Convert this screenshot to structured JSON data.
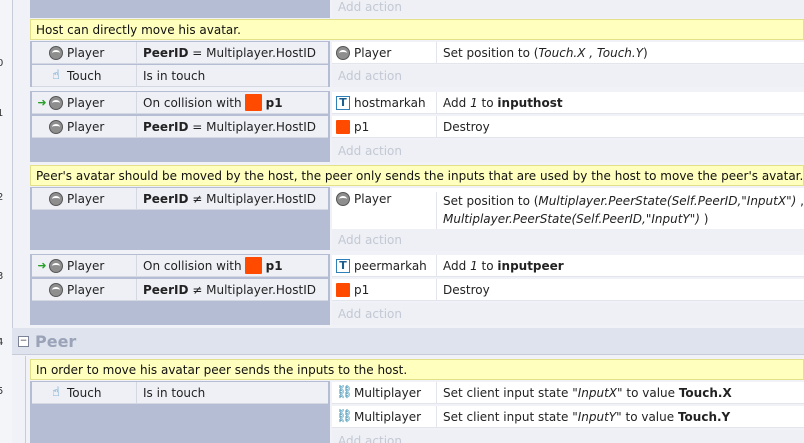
{
  "top_add_action": "Add action",
  "event_numbers": {
    "e10": "0",
    "e11": "1",
    "e12": "2",
    "e13": "3",
    "e14": "4",
    "e15": "5"
  },
  "comments": {
    "c1": "Host can directly move his avatar.",
    "c2": "Peer's avatar should be moved by the host, the peer only sends the inputs that are used by the host to move the peer's avatar.",
    "c3": "In order to move his avatar peer sends the inputs to the host."
  },
  "event10": {
    "cond1": {
      "object": "Player",
      "field": "PeerID",
      "op": "= Multiplayer.HostID"
    },
    "cond2": {
      "object": "Touch",
      "text": "Is in touch"
    },
    "act1": {
      "object": "Player",
      "prefix": "Set position to (",
      "expr": "Touch.X , Touch.Y",
      "suffix": ")"
    },
    "add_action": "Add action"
  },
  "event11": {
    "cond1": {
      "object": "Player",
      "text": "On collision with",
      "target": "p1"
    },
    "cond2": {
      "object": "Player",
      "field": "PeerID",
      "op": "= Multiplayer.HostID"
    },
    "act1": {
      "object": "hostmarkah",
      "prefix": "Add",
      "num": "1",
      "to": "to",
      "var": "inputhost"
    },
    "act2": {
      "object": "p1",
      "text": "Destroy"
    },
    "add_action": "Add action"
  },
  "event12": {
    "cond1": {
      "object": "Player",
      "field": "PeerID",
      "op": "≠ Multiplayer.HostID"
    },
    "act1": {
      "object": "Player",
      "line1_prefix": "Set position to (",
      "line1_expr": "Multiplayer.PeerState(Self.PeerID,\"InputX\")",
      "line1_suffix": " ,",
      "line2_expr": "Multiplayer.PeerState(Self.PeerID,\"InputY\")",
      "line2_suffix": " )"
    },
    "add_action": "Add action"
  },
  "event13": {
    "cond1": {
      "object": "Player",
      "text": "On collision with",
      "target": "p1"
    },
    "cond2": {
      "object": "Player",
      "field": "PeerID",
      "op": "≠ Multiplayer.HostID"
    },
    "act1": {
      "object": "peermarkah",
      "prefix": "Add",
      "num": "1",
      "to": "to",
      "var": "inputpeer"
    },
    "act2": {
      "object": "p1",
      "text": "Destroy"
    },
    "add_action": "Add action"
  },
  "group14": {
    "toggle": "−",
    "name": "Peer"
  },
  "event15": {
    "cond1": {
      "object": "Touch",
      "text": "Is in touch"
    },
    "act1": {
      "object": "Multiplayer",
      "prefix": "Set client input state",
      "key": "\"InputX\"",
      "mid": "to value",
      "value": "Touch.X"
    },
    "act2": {
      "object": "Multiplayer",
      "prefix": "Set client input state",
      "key": "\"InputY\"",
      "mid": "to value",
      "value": "Touch.Y"
    },
    "add_action": "Add action"
  },
  "colors": {
    "comment_bg": "#ffffbe",
    "sprite_red": "#ff4a00",
    "condition_panel": "#b4bdd3",
    "disabled_text": "#c3c8d3"
  },
  "icons": {
    "player": "gear-icon",
    "touch": "touch-icon",
    "text": "text-object-icon",
    "sprite": "red-square-icon",
    "multiplayer": "network-icon",
    "trigger": "green-arrow-icon"
  }
}
